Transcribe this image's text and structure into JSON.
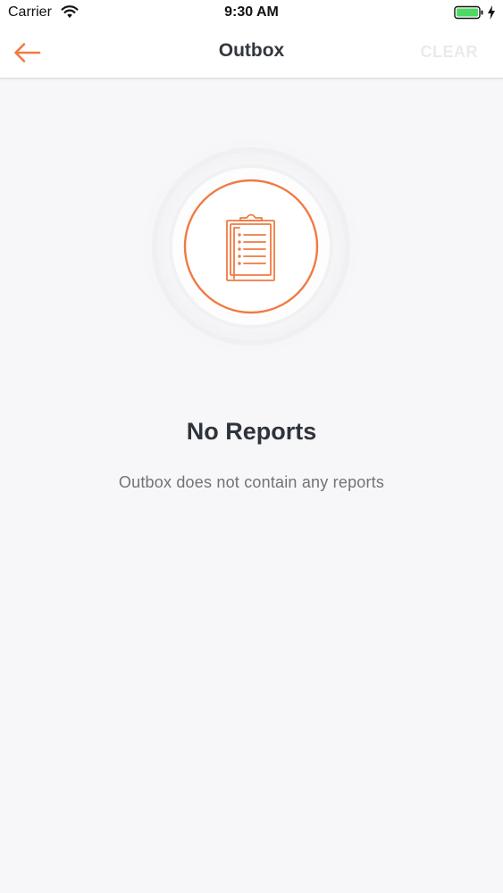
{
  "status_bar": {
    "carrier": "Carrier",
    "time": "9:30 AM",
    "icons": [
      "wifi-icon",
      "battery-icon",
      "charging-icon"
    ]
  },
  "nav": {
    "back_icon": "arrow-left-icon",
    "title": "Outbox",
    "clear_label": "CLEAR"
  },
  "empty_state": {
    "icon": "clipboard-icon",
    "title": "No Reports",
    "subtitle": "Outbox does not contain any reports"
  },
  "colors": {
    "accent": "#f07a42",
    "background": "#f7f7f9",
    "title_text": "#2f333a",
    "subtitle_text": "#6f7378",
    "disabled_action": "#e9eaec",
    "battery_fill": "#4cd964"
  }
}
